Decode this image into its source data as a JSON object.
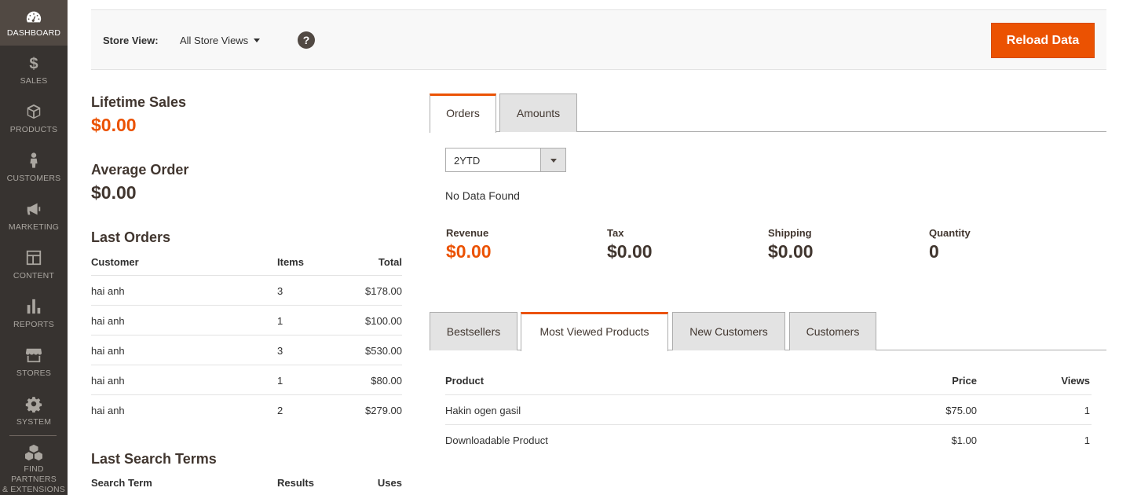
{
  "sidebar": {
    "items": [
      {
        "label": "DASHBOARD",
        "icon": "dashboard-icon"
      },
      {
        "label": "SALES",
        "icon": "dollar-icon"
      },
      {
        "label": "PRODUCTS",
        "icon": "box-icon"
      },
      {
        "label": "CUSTOMERS",
        "icon": "person-icon"
      },
      {
        "label": "MARKETING",
        "icon": "megaphone-icon"
      },
      {
        "label": "CONTENT",
        "icon": "layout-icon"
      },
      {
        "label": "REPORTS",
        "icon": "bar-chart-icon"
      },
      {
        "label": "STORES",
        "icon": "store-icon"
      },
      {
        "label": "SYSTEM",
        "icon": "gear-icon"
      },
      {
        "label_line1": "FIND PARTNERS",
        "label_line2": "& EXTENSIONS",
        "icon": "cubes-icon"
      }
    ]
  },
  "store_bar": {
    "label": "Store View:",
    "selected": "All Store Views",
    "help": "?",
    "reload": "Reload Data"
  },
  "stats": {
    "lifetime_label": "Lifetime Sales",
    "lifetime_value": "$0.00",
    "average_label": "Average Order",
    "average_value": "$0.00"
  },
  "last_orders": {
    "title": "Last Orders",
    "headers": {
      "customer": "Customer",
      "items": "Items",
      "total": "Total"
    },
    "rows": [
      {
        "customer": "hai anh",
        "items": "3",
        "total": "$178.00"
      },
      {
        "customer": "hai anh",
        "items": "1",
        "total": "$100.00"
      },
      {
        "customer": "hai anh",
        "items": "3",
        "total": "$530.00"
      },
      {
        "customer": "hai anh",
        "items": "1",
        "total": "$80.00"
      },
      {
        "customer": "hai anh",
        "items": "2",
        "total": "$279.00"
      }
    ]
  },
  "last_search": {
    "title": "Last Search Terms",
    "headers": {
      "term": "Search Term",
      "results": "Results",
      "uses": "Uses"
    }
  },
  "chart_tabs": {
    "orders": "Orders",
    "amounts": "Amounts"
  },
  "period": {
    "selected": "2YTD"
  },
  "no_data": "No Data Found",
  "totals": {
    "revenue_label": "Revenue",
    "revenue_value": "$0.00",
    "tax_label": "Tax",
    "tax_value": "$0.00",
    "shipping_label": "Shipping",
    "shipping_value": "$0.00",
    "quantity_label": "Quantity",
    "quantity_value": "0"
  },
  "grid_tabs": {
    "bestsellers": "Bestsellers",
    "most_viewed": "Most Viewed Products",
    "new_customers": "New Customers",
    "customers": "Customers"
  },
  "most_viewed": {
    "headers": {
      "product": "Product",
      "price": "Price",
      "views": "Views"
    },
    "rows": [
      {
        "product": "Hakin ogen gasil",
        "price": "$75.00",
        "views": "1"
      },
      {
        "product": "Downloadable Product",
        "price": "$1.00",
        "views": "1"
      }
    ]
  },
  "colors": {
    "accent": "#eb5202",
    "sidebar": "#373330",
    "sidebar_active": "#514943"
  }
}
